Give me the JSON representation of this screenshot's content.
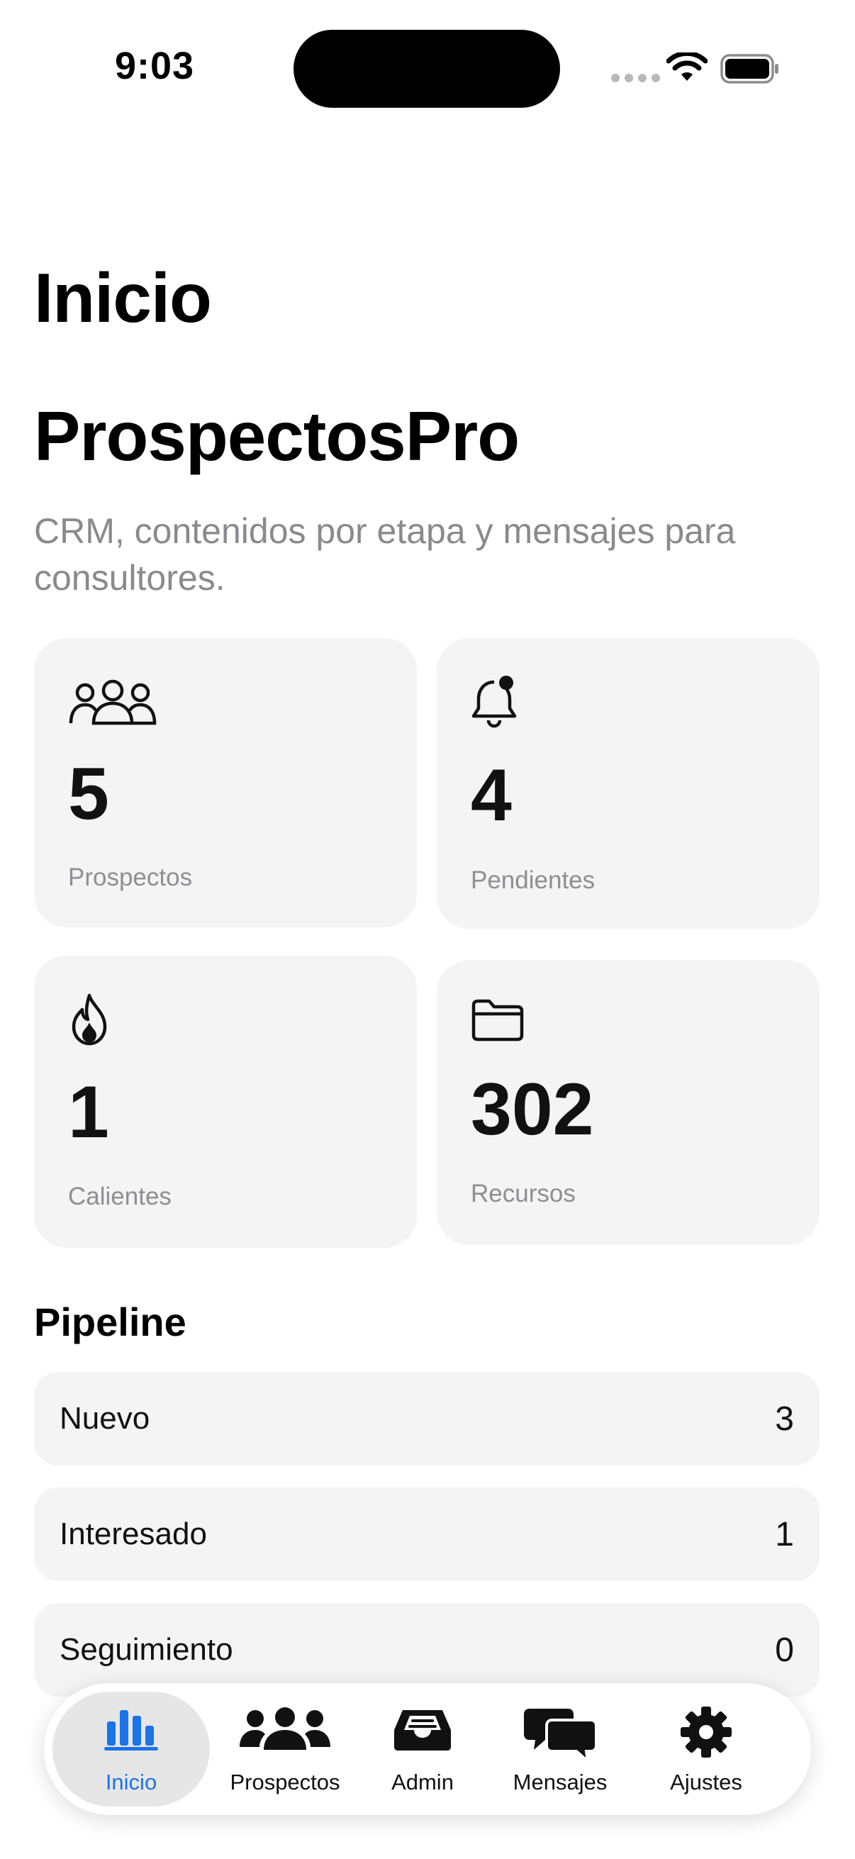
{
  "status_bar": {
    "time": "9:03"
  },
  "header": {
    "large_title": "Inicio",
    "app_name": "ProspectosPro",
    "tagline": "CRM, contenidos por etapa y mensajes para consultores."
  },
  "stats": [
    {
      "icon": "people-icon",
      "value": "5",
      "label": "Prospectos"
    },
    {
      "icon": "bell-badge-icon",
      "value": "4",
      "label": "Pendientes"
    },
    {
      "icon": "flame-icon",
      "value": "1",
      "label": "Calientes"
    },
    {
      "icon": "folder-icon",
      "value": "302",
      "label": "Recursos"
    }
  ],
  "pipeline": {
    "title": "Pipeline",
    "rows": [
      {
        "label": "Nuevo",
        "count": "3"
      },
      {
        "label": "Interesado",
        "count": "1"
      },
      {
        "label": "Seguimiento",
        "count": "0"
      }
    ]
  },
  "tab_bar": {
    "tabs": [
      {
        "label": "Inicio",
        "icon": "chart-bars-icon",
        "active": true
      },
      {
        "label": "Prospectos",
        "icon": "people-fill-icon",
        "active": false
      },
      {
        "label": "Admin",
        "icon": "tray-icon",
        "active": false
      },
      {
        "label": "Mensajes",
        "icon": "chat-bubbles-icon",
        "active": false
      },
      {
        "label": "Ajustes",
        "icon": "gear-icon",
        "active": false
      }
    ],
    "accent_color": "#1a73e8"
  }
}
